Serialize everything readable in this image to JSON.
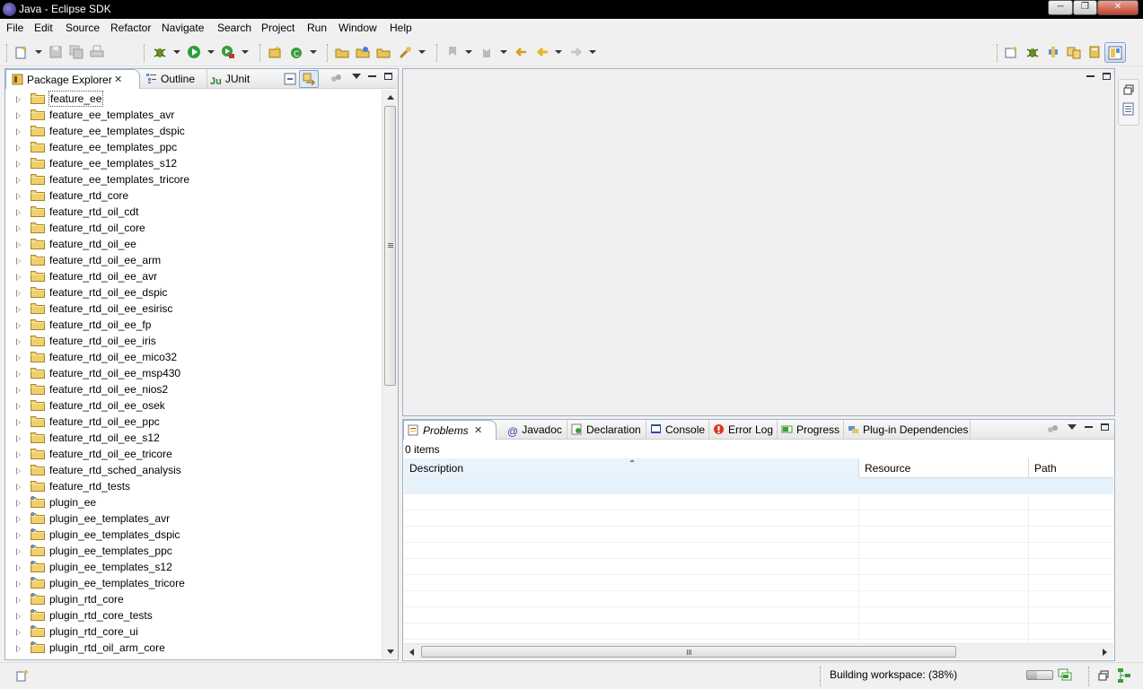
{
  "window": {
    "title": "Java - Eclipse SDK",
    "minimize_glyph": "─",
    "restore_glyph": "❐",
    "close_glyph": "✕"
  },
  "menu": {
    "items": [
      "File",
      "Edit",
      "Source",
      "Refactor",
      "Navigate",
      "Search",
      "Project",
      "Run",
      "Window",
      "Help"
    ]
  },
  "toolbar": {
    "icons": [
      "new-wizard-icon",
      "save-icon",
      "save-all-icon",
      "print-icon",
      "debug-icon",
      "run-icon",
      "external-tools-icon",
      "new-java-project-icon",
      "new-class-icon",
      "open-type-icon",
      "open-task-icon",
      "open-resource-icon",
      "search-icon",
      "next-annotation-icon",
      "previous-annotation-icon",
      "last-edit-location-icon",
      "back-icon",
      "forward-icon"
    ],
    "perspectives": [
      "open-perspective-icon",
      "debug-perspective-icon",
      "plugin-development-perspective-icon",
      "team-synchronizing-icon",
      "resource-perspective-icon",
      "java-perspective-icon"
    ]
  },
  "left_panel": {
    "tabs": [
      {
        "label": "Package Explorer",
        "icon": "package-explorer-icon"
      },
      {
        "label": "Outline",
        "icon": "outline-icon"
      },
      {
        "label": "JUnit",
        "icon": "junit-icon"
      }
    ],
    "items": [
      "feature_ee",
      "feature_ee_templates_avr",
      "feature_ee_templates_dspic",
      "feature_ee_templates_ppc",
      "feature_ee_templates_s12",
      "feature_ee_templates_tricore",
      "feature_rtd_core",
      "feature_rtd_oil_cdt",
      "feature_rtd_oil_core",
      "feature_rtd_oil_ee",
      "feature_rtd_oil_ee_arm",
      "feature_rtd_oil_ee_avr",
      "feature_rtd_oil_ee_dspic",
      "feature_rtd_oil_ee_esirisc",
      "feature_rtd_oil_ee_fp",
      "feature_rtd_oil_ee_iris",
      "feature_rtd_oil_ee_mico32",
      "feature_rtd_oil_ee_msp430",
      "feature_rtd_oil_ee_nios2",
      "feature_rtd_oil_ee_osek",
      "feature_rtd_oil_ee_ppc",
      "feature_rtd_oil_ee_s12",
      "feature_rtd_oil_ee_tricore",
      "feature_rtd_sched_analysis",
      "feature_rtd_tests",
      "plugin_ee",
      "plugin_ee_templates_avr",
      "plugin_ee_templates_dspic",
      "plugin_ee_templates_ppc",
      "plugin_ee_templates_s12",
      "plugin_ee_templates_tricore",
      "plugin_rtd_core",
      "plugin_rtd_core_tests",
      "plugin_rtd_core_ui",
      "plugin_rtd_oil_arm_core"
    ],
    "selected_index": 0
  },
  "bottom_panel": {
    "tabs": [
      {
        "label": "Problems",
        "icon": "problems-icon",
        "active": true
      },
      {
        "label": "Javadoc",
        "icon": "javadoc-icon"
      },
      {
        "label": "Declaration",
        "icon": "declaration-icon"
      },
      {
        "label": "Console",
        "icon": "console-icon"
      },
      {
        "label": "Error Log",
        "icon": "error-log-icon"
      },
      {
        "label": "Progress",
        "icon": "progress-icon"
      },
      {
        "label": "Plug-in Dependencies",
        "icon": "plugin-dependencies-icon"
      }
    ],
    "summary": "0 items",
    "columns": [
      "Description",
      "Resource",
      "Path"
    ]
  },
  "status": {
    "text": "Building workspace: (38%)",
    "progress": 0.38
  },
  "colors": {
    "panel_border": "#9eb1c9",
    "selection_row": "#e5f1fb",
    "folder": "#e8c45a"
  }
}
